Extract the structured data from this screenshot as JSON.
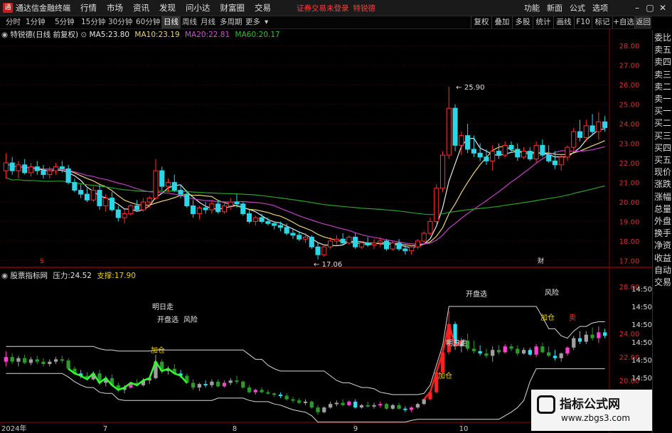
{
  "app": {
    "name": "通达信金融终端",
    "logo": "通"
  },
  "menus": [
    "行情",
    "市场",
    "资讯",
    "发现",
    "问小达",
    "财富圈",
    "交易"
  ],
  "notice": "证券交易未登录",
  "stock_tag": "特锐德",
  "right_menus": [
    "功能",
    "新面",
    "公式",
    "选项"
  ],
  "window_controls": [
    "–",
    "▢",
    "✕"
  ],
  "tabs": [
    "分时",
    "1分钟",
    "5分钟",
    "15分钟",
    "30分钟",
    "60分钟",
    "日线",
    "周线",
    "月线",
    "多周期",
    "更多"
  ],
  "active_tab": "日线",
  "right_tools": [
    "复权",
    "叠加",
    "多股",
    "统计",
    "画线",
    "F10",
    "标记",
    "+自选",
    "返回"
  ],
  "main_info": {
    "name": "特锐德(日线 前复权)",
    "ma5_label": "MA5:",
    "ma5": "23.80",
    "ma10_label": "MA10:",
    "ma10": "23.19",
    "ma20_label": "MA20:",
    "ma20": "22.81",
    "ma60_label": "MA60:",
    "ma60": "20.17"
  },
  "sub_info": {
    "name": "股票指标网",
    "pressure_label": "压力:",
    "pressure": "24.52",
    "support_label": "支撑:",
    "support": "17.90"
  },
  "sidebar": [
    "委比",
    "卖五",
    "卖四",
    "卖三",
    "卖二",
    "卖一",
    "买一",
    "买二",
    "买三",
    "买四",
    "买五",
    "现价",
    "涨跌",
    "涨幅",
    "总量",
    "外盘",
    "换手",
    "净资",
    "收益",
    "自动",
    "交易"
  ],
  "chart_data": {
    "type": "candlestick",
    "price_axis": {
      "min": 16.8,
      "max": 28.3,
      "ticks": [
        "28.00",
        "27.00",
        "26.00",
        "25.00",
        "24.00",
        "23.00",
        "22.00",
        "21.00",
        "20.00",
        "19.00",
        "18.00",
        "17.00"
      ]
    },
    "sub_axis": {
      "ticks": [
        "28.00",
        "24.00",
        "22.00",
        "20.00"
      ]
    },
    "right_time_labels": [
      "14:50",
      "14:50",
      "14:50",
      "14:50",
      "14:50",
      "14:50",
      "14:50",
      "14:50"
    ],
    "x_labels": [
      "2024年",
      "7",
      "8",
      "9",
      "10"
    ],
    "annotations": {
      "high": "25.90",
      "low": "17.06",
      "marker_s": "S",
      "marker_cai": "财"
    },
    "signals": [
      "明日走",
      "开盘选",
      "加仓",
      "风险",
      "风险",
      "加仓",
      "开盘选",
      "明日走",
      "加仓",
      "卖"
    ],
    "candles": [
      [
        21.6,
        22.5,
        21.2,
        22.0
      ],
      [
        22.0,
        22.3,
        21.4,
        21.6
      ],
      [
        21.6,
        22.1,
        21.2,
        21.9
      ],
      [
        21.9,
        22.2,
        21.4,
        21.5
      ],
      [
        21.5,
        22.0,
        21.3,
        21.8
      ],
      [
        21.8,
        22.1,
        21.4,
        21.6
      ],
      [
        21.6,
        21.9,
        21.2,
        21.4
      ],
      [
        21.4,
        21.8,
        21.2,
        21.6
      ],
      [
        21.6,
        22.0,
        21.4,
        21.8
      ],
      [
        21.8,
        22.1,
        21.5,
        21.7
      ],
      [
        21.7,
        21.9,
        20.9,
        21.0
      ],
      [
        21.0,
        21.2,
        20.5,
        20.6
      ],
      [
        20.6,
        20.9,
        20.2,
        20.4
      ],
      [
        20.4,
        20.7,
        20.0,
        20.1
      ],
      [
        20.1,
        20.8,
        20.0,
        20.6
      ],
      [
        20.6,
        20.9,
        19.6,
        19.8
      ],
      [
        19.8,
        20.4,
        19.5,
        20.2
      ],
      [
        20.2,
        20.5,
        19.5,
        19.6
      ],
      [
        19.6,
        19.8,
        19.0,
        19.2
      ],
      [
        19.2,
        19.6,
        18.9,
        19.4
      ],
      [
        19.4,
        19.9,
        19.3,
        19.8
      ],
      [
        19.8,
        20.1,
        19.5,
        19.6
      ],
      [
        19.6,
        20.2,
        19.5,
        20.0
      ],
      [
        20.0,
        20.3,
        19.7,
        20.2
      ],
      [
        20.2,
        22.2,
        20.1,
        21.6
      ],
      [
        21.6,
        21.8,
        20.6,
        20.8
      ],
      [
        20.8,
        21.2,
        20.5,
        21.0
      ],
      [
        21.0,
        21.4,
        20.5,
        20.6
      ],
      [
        20.6,
        20.9,
        20.2,
        20.4
      ],
      [
        20.4,
        20.6,
        19.7,
        19.8
      ],
      [
        19.8,
        20.1,
        19.2,
        19.4
      ],
      [
        19.4,
        19.8,
        19.1,
        19.7
      ],
      [
        19.7,
        20.0,
        19.4,
        19.6
      ],
      [
        19.6,
        20.1,
        19.4,
        19.9
      ],
      [
        19.9,
        20.1,
        19.4,
        19.5
      ],
      [
        19.5,
        20.0,
        19.4,
        19.8
      ],
      [
        19.8,
        20.2,
        19.6,
        20.0
      ],
      [
        20.0,
        20.4,
        19.7,
        19.9
      ],
      [
        19.9,
        20.0,
        19.3,
        19.4
      ],
      [
        19.4,
        19.6,
        18.9,
        19.0
      ],
      [
        19.0,
        19.3,
        18.8,
        19.2
      ],
      [
        19.2,
        19.4,
        18.9,
        19.0
      ],
      [
        19.0,
        19.2,
        18.8,
        18.9
      ],
      [
        18.9,
        19.0,
        18.6,
        18.8
      ],
      [
        18.8,
        19.0,
        18.5,
        18.7
      ],
      [
        18.7,
        18.9,
        18.3,
        18.4
      ],
      [
        18.4,
        18.6,
        18.1,
        18.3
      ],
      [
        18.3,
        18.5,
        18.0,
        18.1
      ],
      [
        18.1,
        18.4,
        17.9,
        18.2
      ],
      [
        18.2,
        18.3,
        17.6,
        17.7
      ],
      [
        17.7,
        17.9,
        17.06,
        17.3
      ],
      [
        17.3,
        17.8,
        17.2,
        17.7
      ],
      [
        17.7,
        18.2,
        17.6,
        18.0
      ],
      [
        18.0,
        18.3,
        17.8,
        18.1
      ],
      [
        18.1,
        18.4,
        17.8,
        17.9
      ],
      [
        17.9,
        18.3,
        17.8,
        18.2
      ],
      [
        18.2,
        18.4,
        17.6,
        17.7
      ],
      [
        17.7,
        18.0,
        17.6,
        17.9
      ],
      [
        17.9,
        18.2,
        17.7,
        17.8
      ],
      [
        17.8,
        18.1,
        17.6,
        17.9
      ],
      [
        17.9,
        18.2,
        17.7,
        18.0
      ],
      [
        18.0,
        18.1,
        17.5,
        17.6
      ],
      [
        17.6,
        18.0,
        17.5,
        17.9
      ],
      [
        17.9,
        18.1,
        17.5,
        17.6
      ],
      [
        17.6,
        17.8,
        17.3,
        17.5
      ],
      [
        17.5,
        17.8,
        17.3,
        17.7
      ],
      [
        17.7,
        18.1,
        17.6,
        18.0
      ],
      [
        18.0,
        18.5,
        17.9,
        18.4
      ],
      [
        18.4,
        19.2,
        18.3,
        19.0
      ],
      [
        19.0,
        20.9,
        18.9,
        20.7
      ],
      [
        20.7,
        22.6,
        20.5,
        22.4
      ],
      [
        22.4,
        25.9,
        22.2,
        24.8
      ],
      [
        24.8,
        25.0,
        22.6,
        22.9
      ],
      [
        22.9,
        23.6,
        22.4,
        23.4
      ],
      [
        23.4,
        24.0,
        22.5,
        22.7
      ],
      [
        22.7,
        23.4,
        22.3,
        22.5
      ],
      [
        22.5,
        23.0,
        22.1,
        22.3
      ],
      [
        22.3,
        22.7,
        21.9,
        22.1
      ],
      [
        22.1,
        22.9,
        21.6,
        22.6
      ],
      [
        22.6,
        23.0,
        22.2,
        22.4
      ],
      [
        22.4,
        23.1,
        22.3,
        22.9
      ],
      [
        22.9,
        23.1,
        22.5,
        22.7
      ],
      [
        22.7,
        23.0,
        22.1,
        22.3
      ],
      [
        22.3,
        22.8,
        22.2,
        22.6
      ],
      [
        22.6,
        22.8,
        22.1,
        22.2
      ],
      [
        22.2,
        23.1,
        22.0,
        22.9
      ],
      [
        22.9,
        23.2,
        22.3,
        22.4
      ],
      [
        22.4,
        22.9,
        22.0,
        22.1
      ],
      [
        22.1,
        22.6,
        21.7,
        21.9
      ],
      [
        21.9,
        22.4,
        21.6,
        22.3
      ],
      [
        22.3,
        22.9,
        22.1,
        22.8
      ],
      [
        22.8,
        23.8,
        22.6,
        23.6
      ],
      [
        23.6,
        24.2,
        23.1,
        23.3
      ],
      [
        23.3,
        24.2,
        23.1,
        23.9
      ],
      [
        23.9,
        24.5,
        23.4,
        23.6
      ],
      [
        23.6,
        24.6,
        23.2,
        24.1
      ],
      [
        24.1,
        24.4,
        23.6,
        23.8
      ]
    ],
    "ma_series": [
      {
        "name": "MA5",
        "color": "#e8e8e8"
      },
      {
        "name": "MA10",
        "color": "#e8d27a"
      },
      {
        "name": "MA20",
        "color": "#c040c0"
      },
      {
        "name": "MA60",
        "color": "#2aa22a"
      }
    ],
    "colors": {
      "up": "#ff3030",
      "down": "#2bd7e6",
      "grid": "#3a0000"
    }
  }
}
